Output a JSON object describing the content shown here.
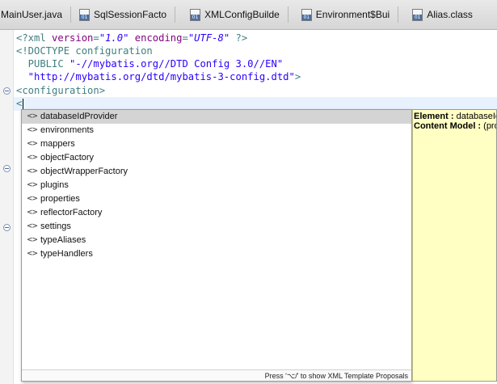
{
  "tabs": [
    {
      "label": "MainUser.java",
      "icon": "none"
    },
    {
      "label": "SqlSessionFacto",
      "icon": "class-file-icon"
    },
    {
      "label": "XMLConfigBuilde",
      "icon": "class-file-icon"
    },
    {
      "label": "Environment$Bui",
      "icon": "class-file-icon"
    },
    {
      "label": "Alias.class",
      "icon": "class-file-icon"
    }
  ],
  "editor": {
    "lines": [
      {
        "pi_open": "<?xml ",
        "attr1": "version",
        "eq1": "=",
        "val1": "\"1.0\"",
        "attr2": " encoding",
        "eq2": "=",
        "val2": "\"UTF-8\"",
        "pi_close": " ?>"
      },
      {
        "text": "<!DOCTYPE configuration"
      },
      {
        "kw": "  PUBLIC ",
        "str": "\"-//mybatis.org//DTD Config 3.0//EN\""
      },
      {
        "str": "  \"http://mybatis.org/dtd/mybatis-3-config.dtd\"",
        "close": ">"
      },
      {
        "text": "<configuration>"
      },
      {
        "text": "<"
      }
    ]
  },
  "assist": {
    "items": [
      "databaseIdProvider",
      "environments",
      "mappers",
      "objectFactory",
      "objectWrapperFactory",
      "plugins",
      "properties",
      "reflectorFactory",
      "settings",
      "typeAliases",
      "typeHandlers"
    ],
    "icon_glyph": "<>",
    "selected_index": 0,
    "status": "Press '⌥/' to show XML Template Proposals"
  },
  "info": {
    "element_label": "Element : ",
    "element_value": "databaseIdProvider",
    "content_label": "Content Model : ",
    "content_value": "(property*)"
  },
  "colors": {
    "selection": "#d4d4d4",
    "info_background": "#ffffc4",
    "current_line": "#e8f2fe",
    "tag": "#3f7f7f",
    "attribute": "#7f007f",
    "string": "#2a00ff"
  }
}
